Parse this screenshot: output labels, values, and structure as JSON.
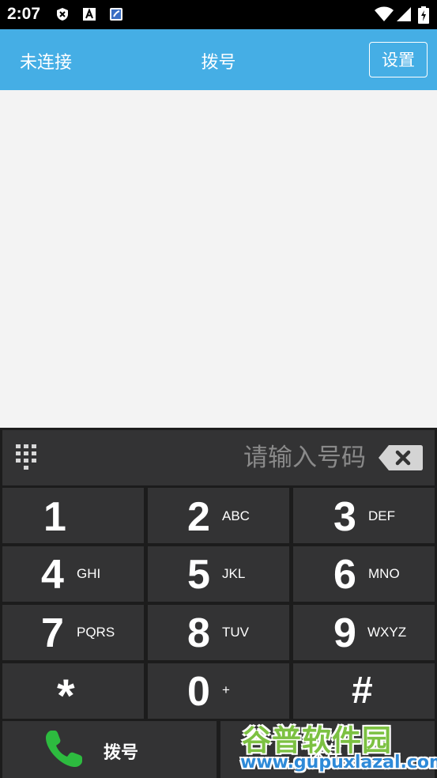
{
  "status_bar": {
    "time": "2:07",
    "icons": [
      "shield-icon",
      "font-a-icon",
      "app-badge-icon",
      "wifi-icon",
      "signal-icon",
      "battery-icon"
    ]
  },
  "header": {
    "connection_status": "未连接",
    "title": "拨号",
    "settings_label": "设置",
    "background_color": "#45aee5"
  },
  "dialpad": {
    "input_placeholder": "请输入号码",
    "input_value": "",
    "keys": [
      {
        "digit": "1",
        "letters": ""
      },
      {
        "digit": "2",
        "letters": "ABC"
      },
      {
        "digit": "3",
        "letters": "DEF"
      },
      {
        "digit": "4",
        "letters": "GHI"
      },
      {
        "digit": "5",
        "letters": "JKL"
      },
      {
        "digit": "6",
        "letters": "MNO"
      },
      {
        "digit": "7",
        "letters": "PQRS"
      },
      {
        "digit": "8",
        "letters": "TUV"
      },
      {
        "digit": "9",
        "letters": "WXYZ"
      },
      {
        "digit": "*",
        "letters": ""
      },
      {
        "digit": "0",
        "letters": "+"
      },
      {
        "digit": "#",
        "letters": ""
      }
    ],
    "call_label": "拨号",
    "hangup_label": "保存",
    "call_icon_color": "#2dbb3f"
  },
  "watermark": {
    "brand": "谷普软件园",
    "url": "www.gupuxlazal.com"
  }
}
